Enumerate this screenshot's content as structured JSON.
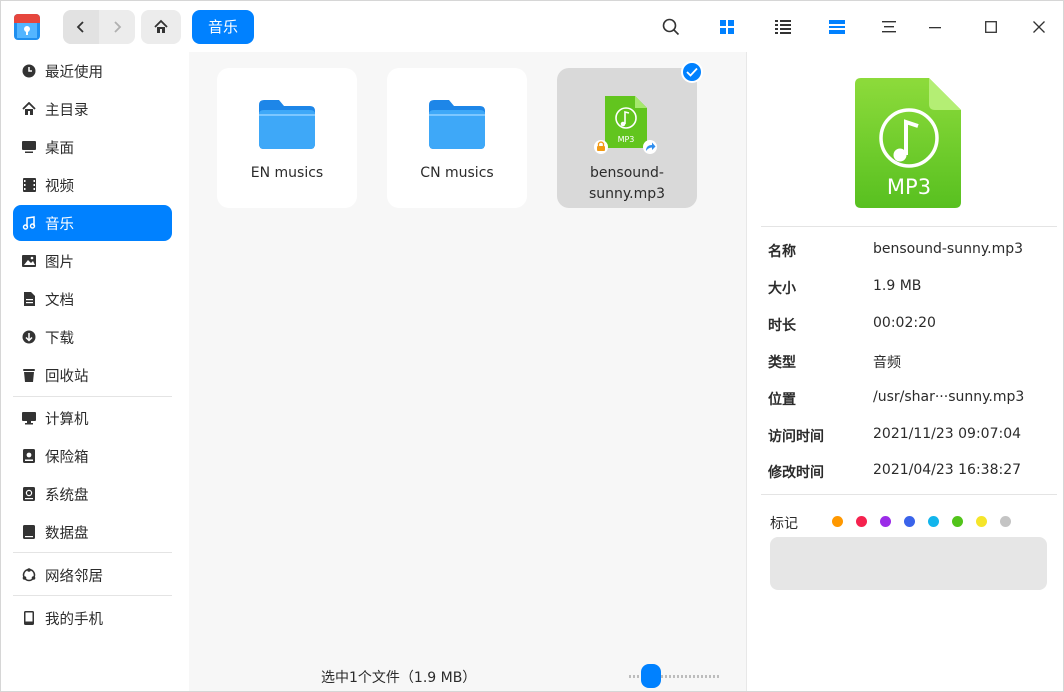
{
  "toolbar": {
    "breadcrumb": "音乐"
  },
  "sidebar": {
    "items": [
      {
        "label": "最近使用",
        "icon": "clock-icon"
      },
      {
        "label": "主目录",
        "icon": "home-icon"
      },
      {
        "label": "桌面",
        "icon": "desktop-icon"
      },
      {
        "label": "视频",
        "icon": "video-icon"
      },
      {
        "label": "音乐",
        "icon": "music-icon"
      },
      {
        "label": "图片",
        "icon": "picture-icon"
      },
      {
        "label": "文档",
        "icon": "document-icon"
      },
      {
        "label": "下载",
        "icon": "download-icon"
      },
      {
        "label": "回收站",
        "icon": "trash-icon"
      },
      {
        "label": "计算机",
        "icon": "computer-icon"
      },
      {
        "label": "保险箱",
        "icon": "vault-icon"
      },
      {
        "label": "系统盘",
        "icon": "disk-icon"
      },
      {
        "label": "数据盘",
        "icon": "disk-icon"
      },
      {
        "label": "网络邻居",
        "icon": "network-icon"
      },
      {
        "label": "我的手机",
        "icon": "phone-icon"
      }
    ]
  },
  "files": [
    {
      "name": "EN musics",
      "type": "folder"
    },
    {
      "name": "CN musics",
      "type": "folder"
    },
    {
      "name_line1": "bensound-",
      "name_line2": "sunny.mp3",
      "type": "mp3",
      "icon_text": "MP3"
    }
  ],
  "status": {
    "text": "选中1个文件（1.9 MB）"
  },
  "detail": {
    "icon_text": "MP3",
    "properties": [
      {
        "key": "名称",
        "value": "bensound-sunny.mp3"
      },
      {
        "key": "大小",
        "value": "1.9 MB"
      },
      {
        "key": "时长",
        "value": "00:02:20"
      },
      {
        "key": "类型",
        "value": "音频"
      },
      {
        "key": "位置",
        "value": "/usr/shar···sunny.mp3"
      },
      {
        "key": "访问时间",
        "value": "2021/11/23 09:07:04"
      },
      {
        "key": "修改时间",
        "value": "2021/04/23 16:38:27"
      }
    ],
    "tag_label": "标记",
    "tag_colors": [
      "#ff9800",
      "#f5224e",
      "#9b2ce8",
      "#3a63ea",
      "#12b5ec",
      "#52c41a",
      "#f5e52a",
      "#c4c4c4"
    ]
  },
  "colors": {
    "accent": "#0081ff",
    "folder": "#2b9bf4",
    "mp3": "#6fd12b"
  }
}
